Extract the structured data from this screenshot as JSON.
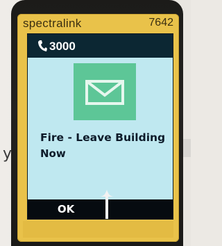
{
  "background": {
    "text_fragment_top": "",
    "text_fragment_bottom": "y."
  },
  "device": {
    "brand": "spectralink",
    "extension": "7642",
    "frame_color": "#e9c24a"
  },
  "status_bar": {
    "line_icon": "phone-icon",
    "line_number": "3000"
  },
  "message": {
    "icon": "envelope-icon",
    "icon_bg_color": "#5dc697",
    "line1": "Fire - Leave Building",
    "line2": "Now"
  },
  "softkeys": {
    "left_label": "OK",
    "right_label": ""
  },
  "colors": {
    "screen_bg": "#bfe8f0",
    "status_bar_bg": "#0c2733",
    "softkey_bg": "#060b10"
  }
}
